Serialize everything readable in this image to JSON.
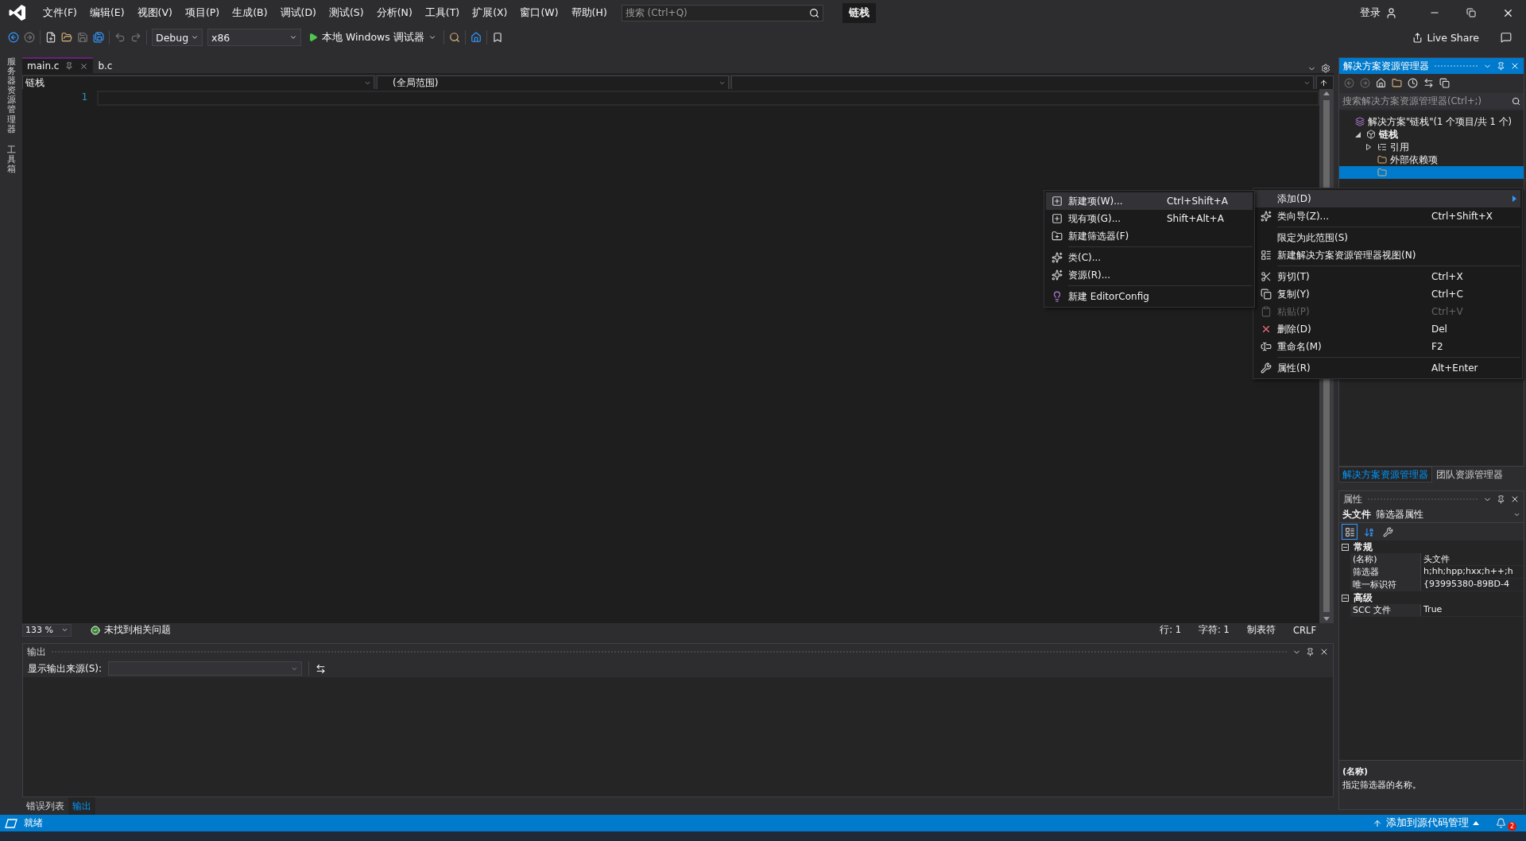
{
  "app_title": "链栈",
  "menu": [
    "文件(F)",
    "编辑(E)",
    "视图(V)",
    "项目(P)",
    "生成(B)",
    "调试(D)",
    "测试(S)",
    "分析(N)",
    "工具(T)",
    "扩展(X)",
    "窗口(W)",
    "帮助(H)"
  ],
  "search": {
    "placeholder": "搜索 (Ctrl+Q)"
  },
  "account": {
    "label": "登录"
  },
  "toolbar": {
    "configuration": "Debug",
    "platform": "x86",
    "run": "本地 Windows 调试器",
    "live_share": "Live Share"
  },
  "left_strip": [
    "服务器资源管理器",
    "工具箱"
  ],
  "editor": {
    "tabs": [
      {
        "label": "main.c",
        "selected": true
      },
      {
        "label": "b.c",
        "selected": false
      }
    ],
    "nav": [
      "链栈",
      "(全局范围)"
    ],
    "line_numbers": [
      "1"
    ],
    "zoom": "133 %",
    "issues": "未找到相关问题",
    "position": [
      "行: 1",
      "字符: 1",
      "制表符",
      "CRLF"
    ]
  },
  "output": {
    "title": "输出",
    "source_label": "显示输出来源(S):"
  },
  "bottom_tabs": [
    {
      "label": "错误列表",
      "selected": false
    },
    {
      "label": "输出",
      "selected": true
    }
  ],
  "solution_explorer": {
    "title": "解决方案资源管理器",
    "search_placeholder": "搜索解决方案资源管理器(Ctrl+;)",
    "tree": [
      {
        "label": "解决方案\"链栈\"(1 个项目/共 1 个)",
        "kind": "solution",
        "selected": false,
        "children": [
          {
            "label": "链栈",
            "kind": "project",
            "expanded": true,
            "selected": false,
            "children": [
              {
                "label": "引用",
                "kind": "references",
                "expanded": false,
                "selected": false
              },
              {
                "label": "外部依赖项",
                "kind": "folder",
                "selected": false
              },
              {
                "kind": "folder",
                "selected": true
              }
            ]
          }
        ]
      }
    ]
  },
  "right_tabs": [
    {
      "label": "解决方案资源管理器",
      "selected": true
    },
    {
      "label": "团队资源管理器",
      "selected": false
    }
  ],
  "properties": {
    "title": "属性",
    "object_name": "头文件",
    "object_type": "筛选器属性",
    "categories": [
      {
        "name": "常规",
        "expanded": true,
        "rows": [
          {
            "name": "(名称)",
            "value": "头文件"
          },
          {
            "name": "筛选器",
            "value": "h;hh;hpp;hxx;h++;h"
          },
          {
            "name": "唯一标识符",
            "value": "{93995380-89BD-4"
          }
        ]
      },
      {
        "name": "高级",
        "expanded": true,
        "rows": [
          {
            "name": "SCC 文件",
            "value": "True"
          }
        ]
      }
    ],
    "description_title": "(名称)",
    "description": "指定筛选器的名称。"
  },
  "status_bar": {
    "text": "就绪",
    "source_control": "添加到源代码管理",
    "notifications": "2"
  },
  "context_menu": [
    {
      "kind": "item",
      "label": "添加(D)",
      "highlighted": true,
      "disabled": false,
      "submenu": true
    },
    {
      "kind": "item",
      "label": "类向导(Z)...",
      "shortcut": "Ctrl+Shift+X",
      "highlighted": false,
      "disabled": false
    },
    {
      "kind": "separator"
    },
    {
      "kind": "item",
      "label": "限定为此范围(S)",
      "highlighted": false,
      "disabled": false
    },
    {
      "kind": "item",
      "label": "新建解决方案资源管理器视图(N)",
      "highlighted": false,
      "disabled": false
    },
    {
      "kind": "separator"
    },
    {
      "kind": "item",
      "label": "剪切(T)",
      "shortcut": "Ctrl+X",
      "highlighted": false,
      "disabled": false
    },
    {
      "kind": "item",
      "label": "复制(Y)",
      "shortcut": "Ctrl+C",
      "highlighted": false,
      "disabled": false
    },
    {
      "kind": "item",
      "label": "粘贴(P)",
      "shortcut": "Ctrl+V",
      "highlighted": false,
      "disabled": true
    },
    {
      "kind": "item",
      "label": "删除(D)",
      "shortcut": "Del",
      "highlighted": false,
      "disabled": false
    },
    {
      "kind": "item",
      "label": "重命名(M)",
      "shortcut": "F2",
      "highlighted": false,
      "disabled": false
    },
    {
      "kind": "separator"
    },
    {
      "kind": "item",
      "label": "属性(R)",
      "shortcut": "Alt+Enter",
      "highlighted": false,
      "disabled": false
    }
  ],
  "submenu": [
    {
      "kind": "item",
      "label": "新建项(W)...",
      "shortcut": "Ctrl+Shift+A",
      "highlighted": true,
      "disabled": false
    },
    {
      "kind": "item",
      "label": "现有项(G)...",
      "shortcut": "Shift+Alt+A",
      "highlighted": false,
      "disabled": false
    },
    {
      "kind": "item",
      "label": "新建筛选器(F)",
      "highlighted": false,
      "disabled": false
    },
    {
      "kind": "separator"
    },
    {
      "kind": "item",
      "label": "类(C)...",
      "highlighted": false,
      "disabled": false
    },
    {
      "kind": "item",
      "label": "资源(R)...",
      "highlighted": false,
      "disabled": false
    },
    {
      "kind": "separator"
    },
    {
      "kind": "item",
      "label": "新建 EditorConfig",
      "highlighted": false,
      "disabled": false
    }
  ]
}
